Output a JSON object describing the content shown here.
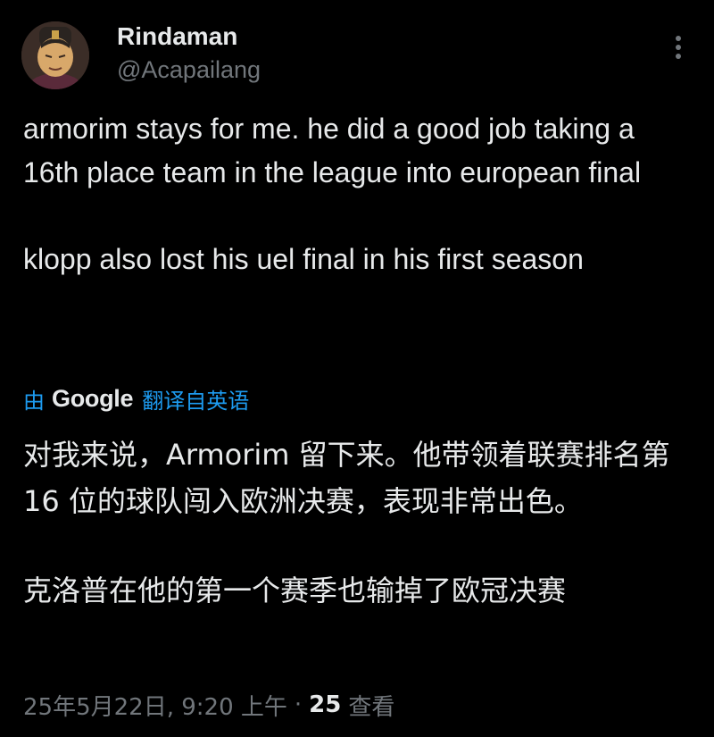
{
  "author": {
    "display_name": "Rindaman",
    "handle": "@Acapailang",
    "avatar_icon": "cartoon-character-avatar"
  },
  "tweet": {
    "paragraphs": [
      "armorim stays for me. he did a good job taking a 16th place team in the league into european final",
      "klopp also lost his uel final in his first season"
    ]
  },
  "translation": {
    "by_label": "由",
    "provider": "Google",
    "action_label": "翻译自英语",
    "paragraphs": [
      "对我来说，Armorim 留下来。他带领着联赛排名第 16 位的球队闯入欧洲决赛，表现非常出色。",
      "克洛普在他的第一个赛季也输掉了欧冠决赛"
    ]
  },
  "meta": {
    "timestamp": "25年5月22日, 9:20 上午",
    "separator": "·",
    "view_count": "25",
    "view_label": "查看"
  },
  "colors": {
    "background": "#000000",
    "text_primary": "#e7e9ea",
    "text_secondary": "#71767b",
    "link": "#1d9bf0"
  }
}
